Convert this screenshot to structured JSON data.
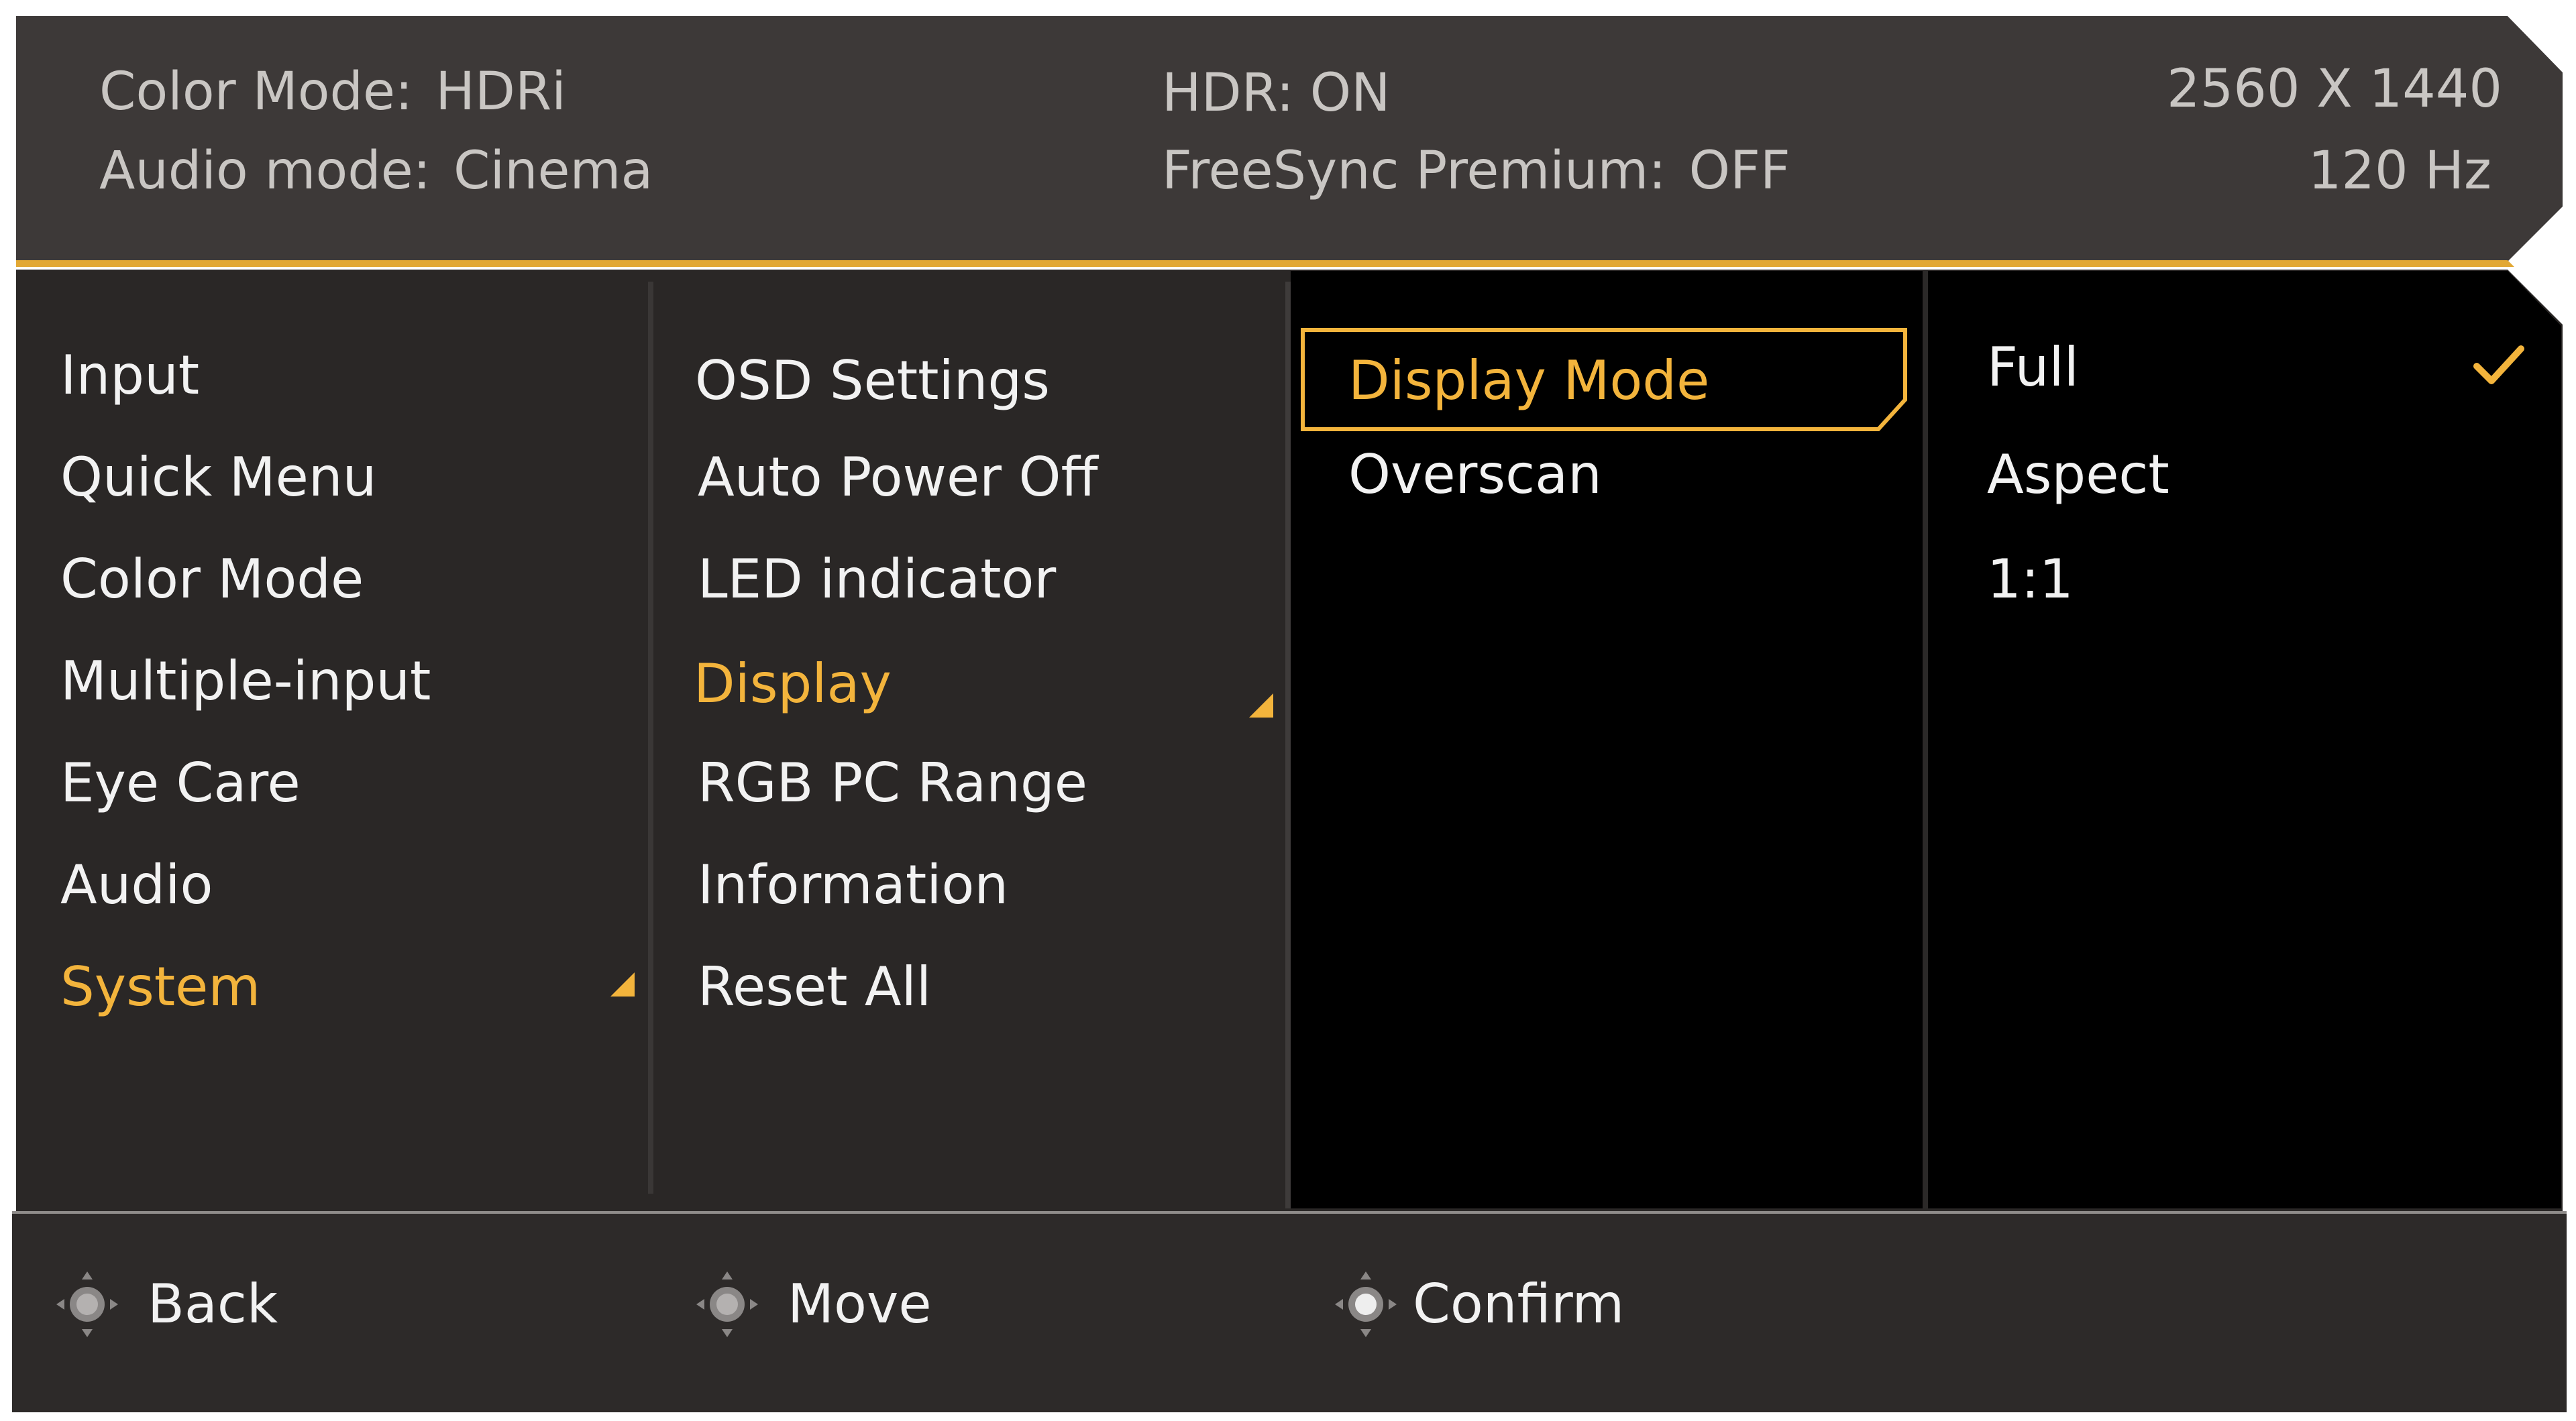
{
  "header": {
    "color_mode_label": "Color Mode:",
    "color_mode_value": "HDRi",
    "audio_mode_label": "Audio mode:",
    "audio_mode_value": "Cinema",
    "hdr_label": "HDR:",
    "hdr_value": "ON",
    "freesync_label": "FreeSync Premium:",
    "freesync_value": "OFF",
    "resolution": "2560 X 1440",
    "refresh_rate": "120 Hz"
  },
  "menu_level1": {
    "items": [
      "Input",
      "Quick Menu",
      "Color Mode",
      "Multiple-input",
      "Eye Care",
      "Audio",
      "System"
    ],
    "active_index": 6
  },
  "menu_level2": {
    "items": [
      "OSD Settings",
      "Auto Power Off",
      "LED indicator",
      "Display",
      "RGB PC Range",
      "Information",
      "Reset All"
    ],
    "active_index": 3
  },
  "menu_level3": {
    "items": [
      "Display Mode",
      "Overscan"
    ],
    "selected_index": 0
  },
  "menu_level4": {
    "items": [
      "Full",
      "Aspect",
      "1:1"
    ],
    "checked_index": 0
  },
  "footer": {
    "back": "Back",
    "move": "Move",
    "confirm": "Confirm"
  },
  "colors": {
    "accent": "#f3b43c",
    "header_bg": "#3d3938",
    "panel_bg": "#2a2726",
    "dark_bg": "#000000",
    "footer_bg": "#2d2a29",
    "text": "#f2f2f2",
    "header_text": "#c9c6c3"
  },
  "icons": {
    "footer": "joystick-icon",
    "check": "checkmark-icon",
    "submenu": "submenu-arrow-icon"
  }
}
